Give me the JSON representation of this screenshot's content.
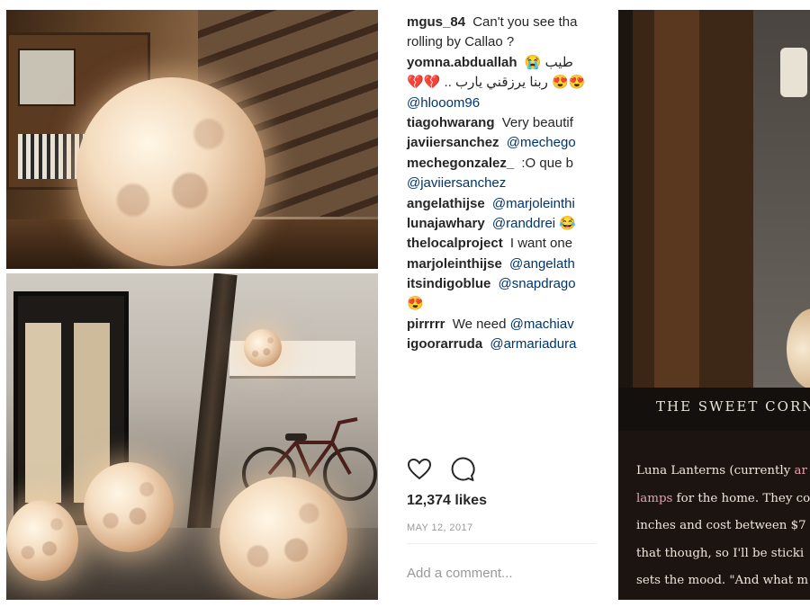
{
  "photos": {
    "top_alt": "",
    "bottom_alt": ""
  },
  "instagram": {
    "comments": [
      {
        "segments": [
          {
            "t": "user",
            "v": "mgus_84"
          },
          {
            "t": "text",
            "v": "Can't you see tha"
          }
        ]
      },
      {
        "segments": [
          {
            "t": "text",
            "v": "rolling by Callao ?"
          }
        ]
      },
      {
        "segments": [
          {
            "t": "user",
            "v": "yomna.abduallah"
          },
          {
            "t": "text",
            "v": "😭 طيب"
          }
        ]
      },
      {
        "segments": [
          {
            "t": "text",
            "v": "💔💔 .. ربنا يرزقني يارب 😍😍"
          }
        ]
      },
      {
        "segments": [
          {
            "t": "mention",
            "v": "@hlooom96"
          }
        ]
      },
      {
        "segments": [
          {
            "t": "user",
            "v": "tiagohwarang"
          },
          {
            "t": "text",
            "v": "Very beautif"
          }
        ]
      },
      {
        "segments": [
          {
            "t": "user",
            "v": "javiiersanchez"
          },
          {
            "t": "mention",
            "v": "@mechego"
          }
        ]
      },
      {
        "segments": [
          {
            "t": "user",
            "v": "mechegonzalez_"
          },
          {
            "t": "text",
            "v": ":O que b"
          }
        ]
      },
      {
        "segments": [
          {
            "t": "mention",
            "v": "@javiiersanchez"
          }
        ]
      },
      {
        "segments": [
          {
            "t": "user",
            "v": "angelathijse"
          },
          {
            "t": "mention",
            "v": "@marjoleinthi"
          }
        ]
      },
      {
        "segments": [
          {
            "t": "user",
            "v": "lunajawhary"
          },
          {
            "t": "mention",
            "v": "@randdrei"
          },
          {
            "t": "text",
            "v": "😂"
          }
        ]
      },
      {
        "segments": [
          {
            "t": "user",
            "v": "thelocalproject"
          },
          {
            "t": "text",
            "v": "I want one"
          }
        ]
      },
      {
        "segments": [
          {
            "t": "user",
            "v": "marjoleinthijse"
          },
          {
            "t": "mention",
            "v": "@angelath"
          }
        ]
      },
      {
        "segments": [
          {
            "t": "user",
            "v": "itsindigoblue"
          },
          {
            "t": "mention",
            "v": "@snapdrago"
          }
        ]
      },
      {
        "segments": [
          {
            "t": "text",
            "v": "😍"
          }
        ]
      },
      {
        "segments": [
          {
            "t": "user",
            "v": "pirrrrr"
          },
          {
            "t": "text",
            "v": "We need"
          },
          {
            "t": "mention",
            "v": "@machiav"
          }
        ]
      },
      {
        "segments": [
          {
            "t": "user",
            "v": "igoorarruda"
          },
          {
            "t": "mention",
            "v": "@armariadura"
          }
        ]
      }
    ],
    "icons": {
      "like": "heart-icon",
      "comment": "comment-icon"
    },
    "likes": "12,374 likes",
    "date": "MAY 12, 2017",
    "add_comment_placeholder": "Add a comment..."
  },
  "article": {
    "caption": "THE SWEET CORN",
    "lines": [
      [
        {
          "t": "text",
          "v": "Luna Lanterns (currently "
        },
        {
          "t": "link",
          "v": "ar"
        }
      ],
      [
        {
          "t": "link",
          "v": "lamps"
        },
        {
          "t": "text",
          "v": " for the home. They co"
        }
      ],
      [
        {
          "t": "text",
          "v": "inches and cost between $7"
        }
      ],
      [
        {
          "t": "text",
          "v": "that though, so I'll be sticki"
        }
      ],
      [
        {
          "t": "text",
          "v": "sets the mood. \"And what m"
        }
      ]
    ]
  },
  "colors": {
    "ig_text": "#262626",
    "ig_mention": "#003569",
    "ig_muted": "#999999",
    "article_bg": "#1c1410",
    "article_link": "#e5a3b0"
  }
}
